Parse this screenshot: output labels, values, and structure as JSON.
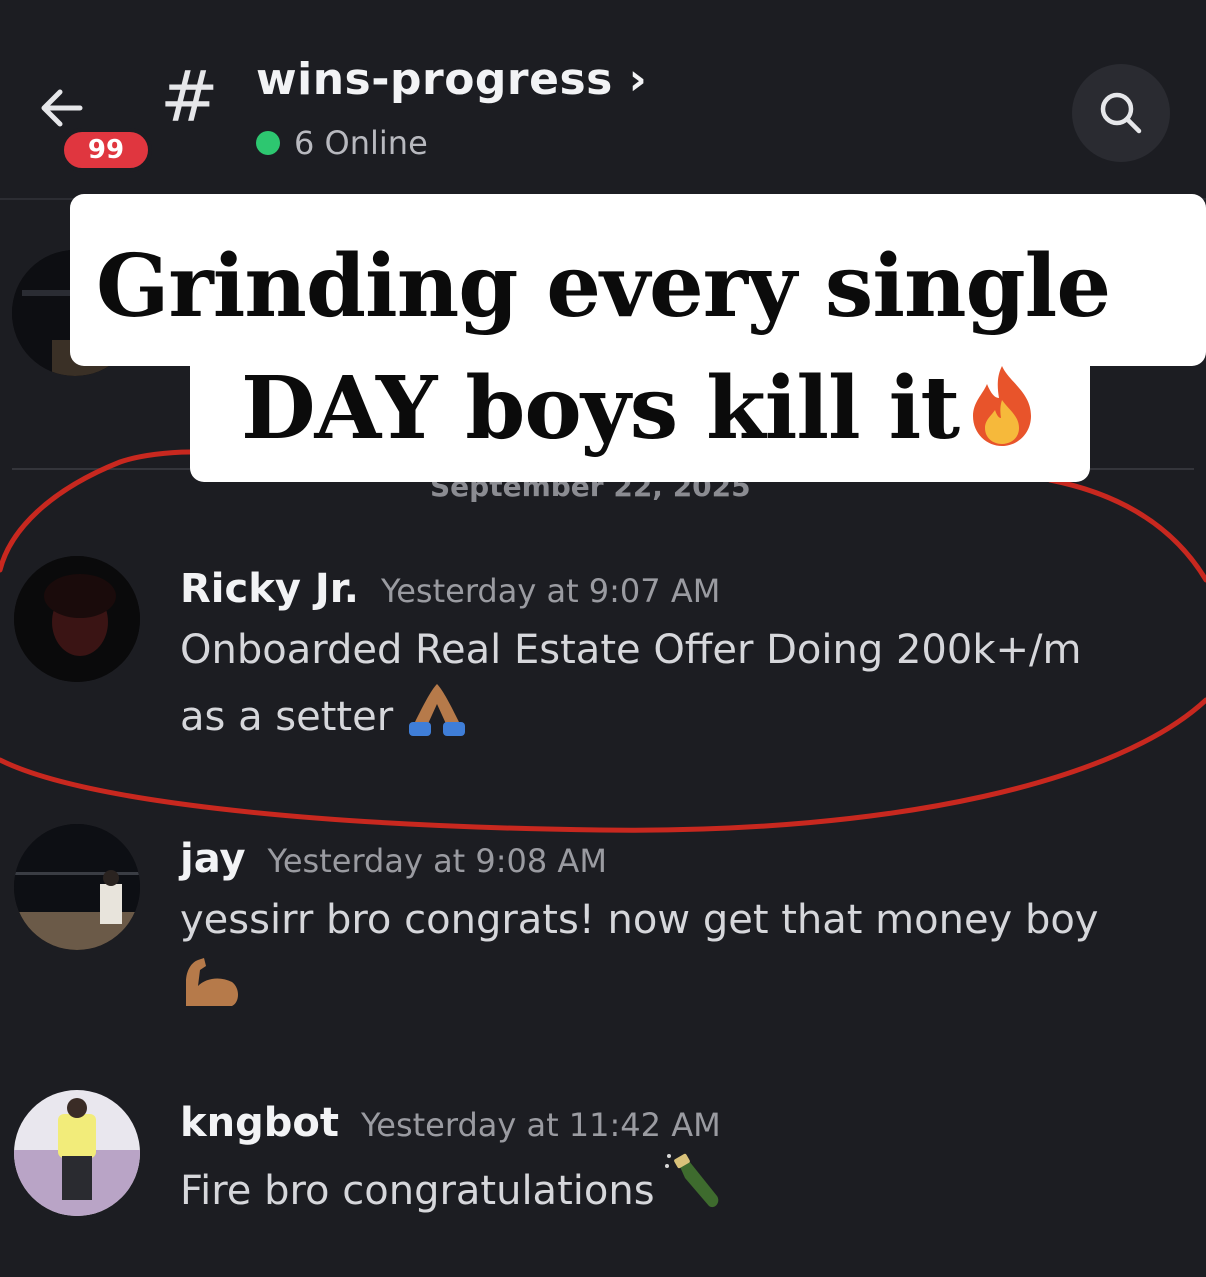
{
  "header": {
    "channel_name": "wins-progress ›",
    "unread_badge": "99",
    "online_text": "6 Online",
    "hash_symbol": "#",
    "icons": [
      "back-arrow-icon",
      "search-icon"
    ]
  },
  "overlay": {
    "line1": "Grinding every single",
    "line2": "DAY boys kill it",
    "emoji": "fire-emoji"
  },
  "date_divider": "September 22, 2025",
  "messages": [
    {
      "username": "Ricky Jr.",
      "timestamp": "Yesterday at 9:07 AM",
      "line1": "Onboarded Real Estate Offer Doing 200k+/m",
      "line2": "as a setter",
      "emoji": "folded-hands-emoji"
    },
    {
      "username": "jay",
      "timestamp": "Yesterday at 9:08 AM",
      "line1": "yessirr bro congrats! now get that money boy",
      "emoji": "flexed-biceps-emoji"
    },
    {
      "username": "kngbot",
      "timestamp": "Yesterday at 11:42 AM",
      "line1": "Fire bro congratulations",
      "emoji": "champagne-emoji"
    }
  ],
  "colors": {
    "background": "#1c1d22",
    "online": "#2dc770",
    "badge": "#e0363f",
    "annotation": "#c8281f"
  }
}
